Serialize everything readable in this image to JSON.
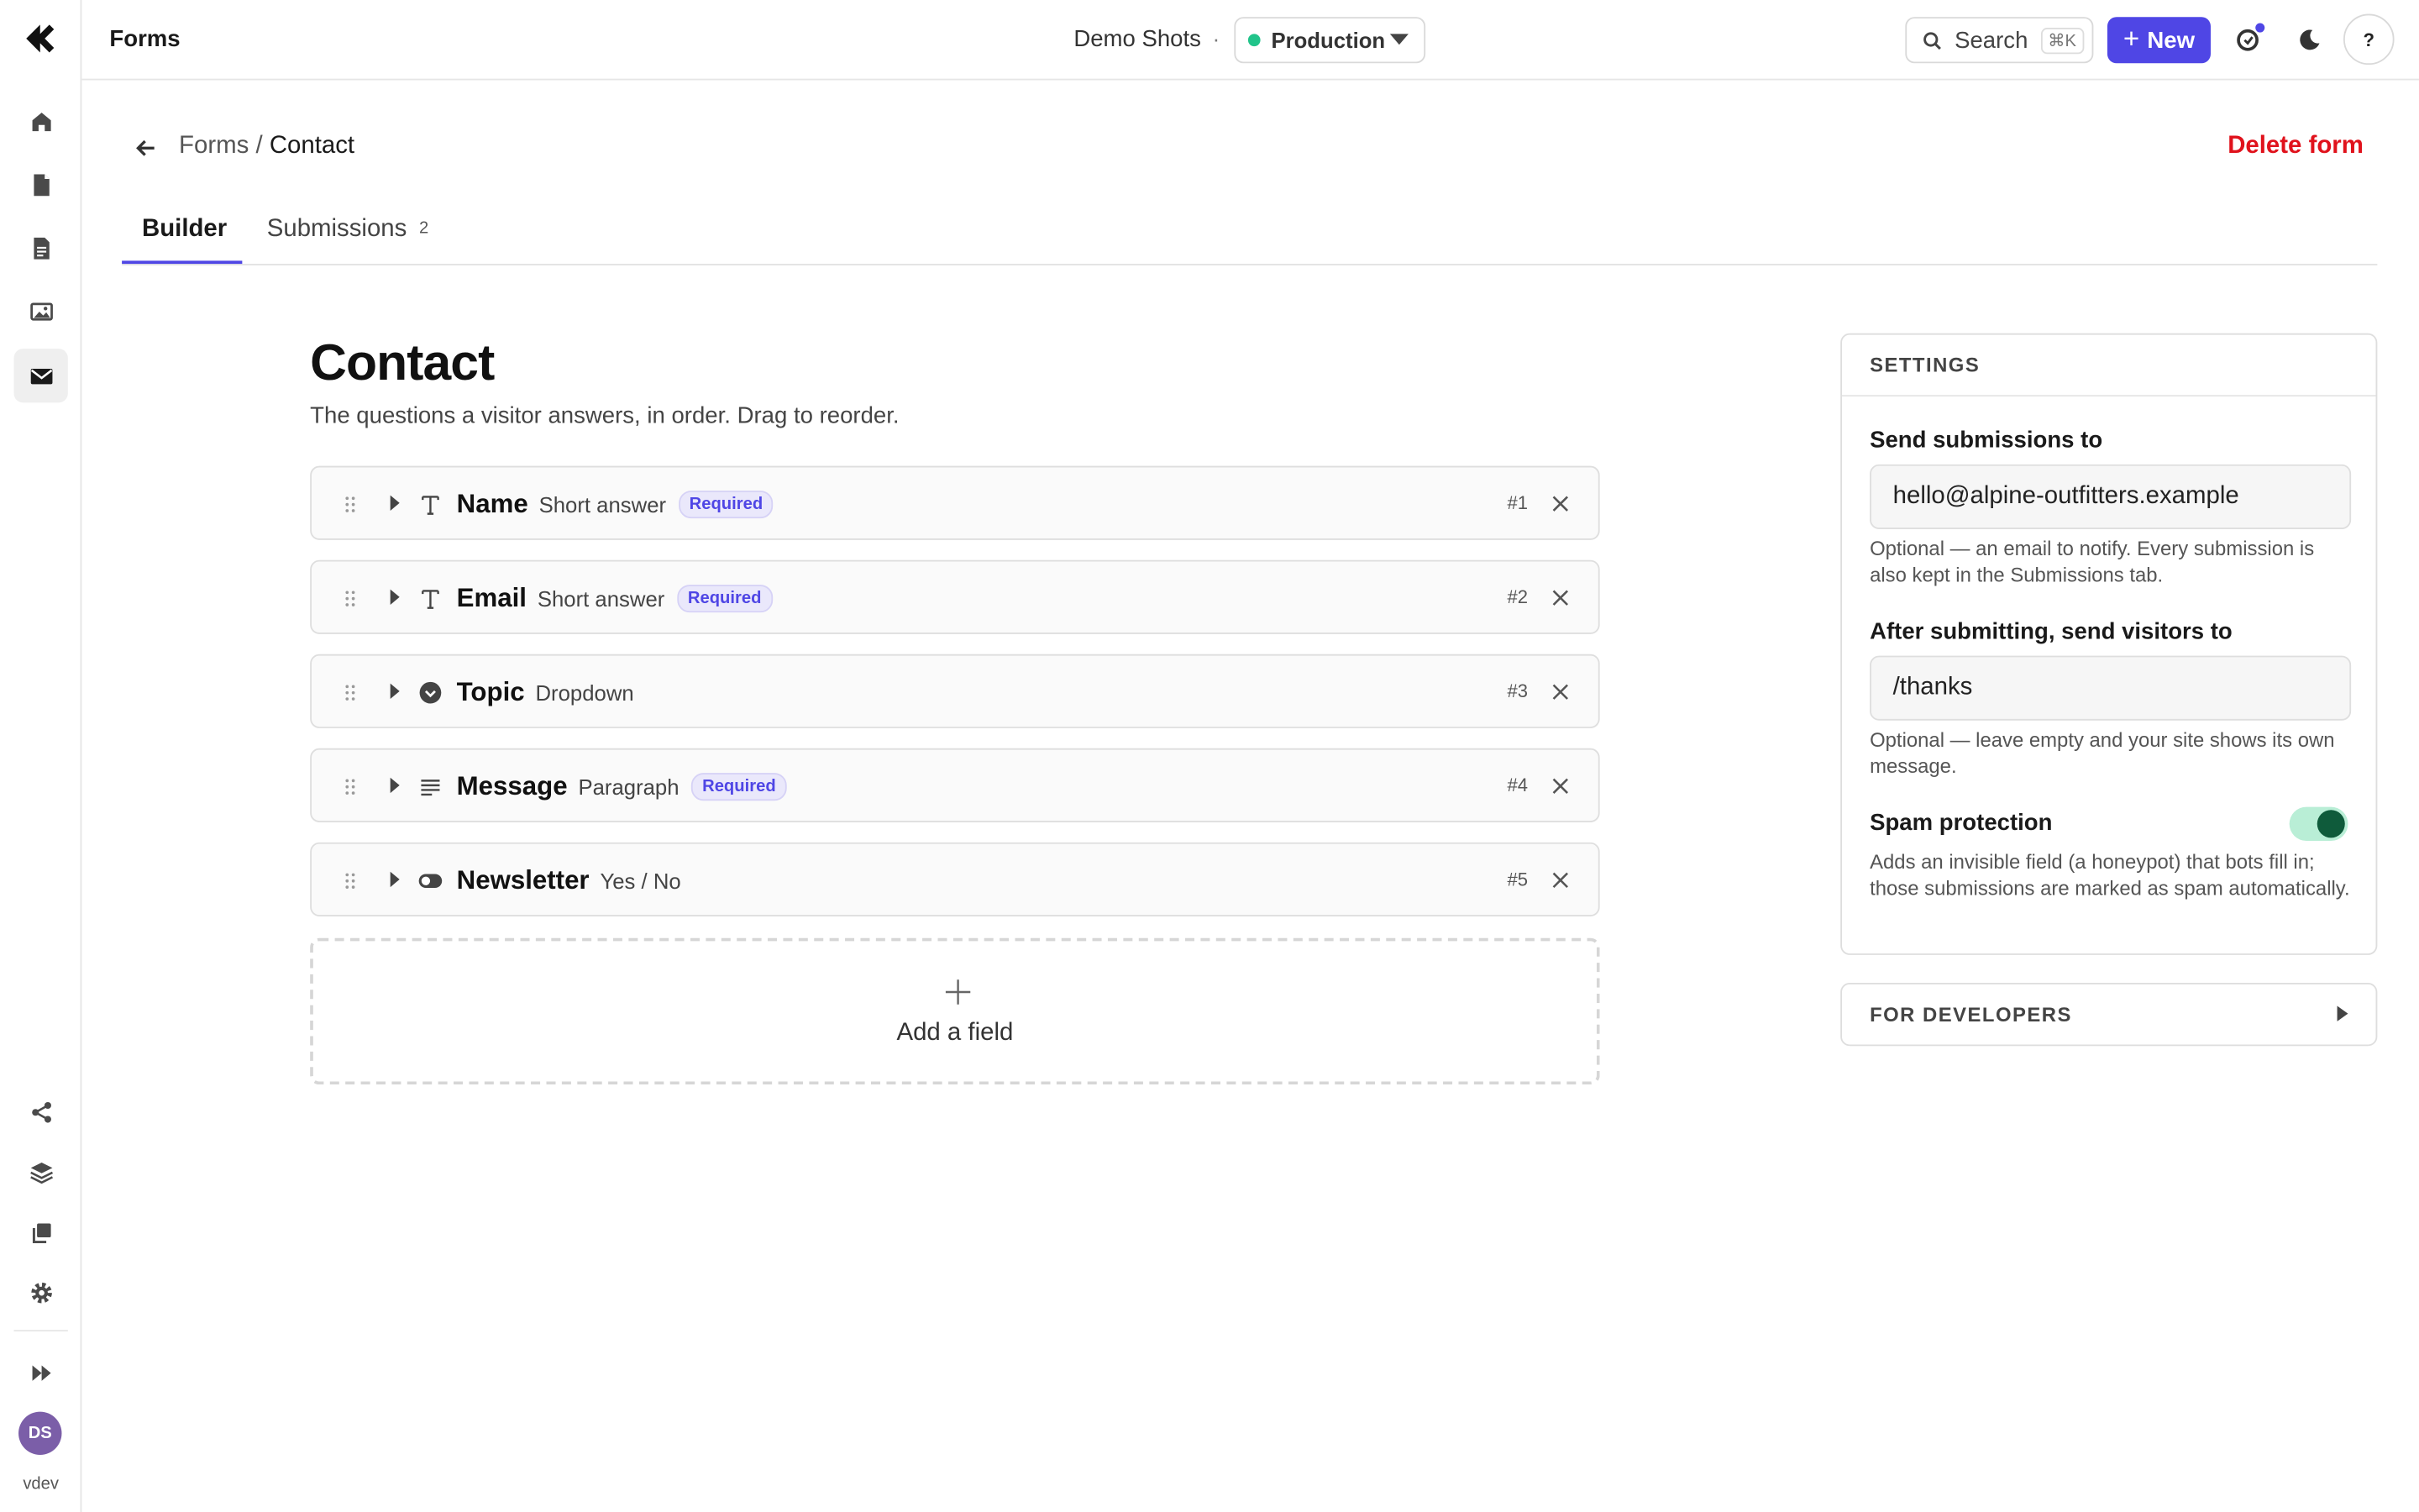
{
  "topbar": {
    "app_title": "Forms",
    "project": "Demo Shots",
    "separator": "·",
    "environment": "Production",
    "search_label": "Search",
    "search_shortcut": "⌘K",
    "new_label": "New",
    "help_label": "?"
  },
  "sidebar": {
    "items": [
      {
        "icon": "home-icon"
      },
      {
        "icon": "file-icon"
      },
      {
        "icon": "document-icon"
      },
      {
        "icon": "image-icon"
      },
      {
        "icon": "mail-icon",
        "active": true
      }
    ],
    "bottom_items": [
      {
        "icon": "share-icon"
      },
      {
        "icon": "layers-icon"
      },
      {
        "icon": "copy-icon"
      },
      {
        "icon": "gear-icon"
      },
      {
        "icon": "fast-forward-icon"
      }
    ],
    "avatar_initials": "DS",
    "user": "vdev"
  },
  "header": {
    "breadcrumb_parent": "Forms",
    "breadcrumb_sep": " / ",
    "breadcrumb_current": "Contact",
    "delete_label": "Delete form"
  },
  "tabs": [
    {
      "label": "Builder",
      "active": true
    },
    {
      "label": "Submissions",
      "count": "2"
    }
  ],
  "form": {
    "title": "Contact",
    "subtitle": "The questions a visitor answers, in order. Drag to reorder.",
    "fields": [
      {
        "name": "Name",
        "type": "Short answer",
        "required": "Required",
        "number": "#1",
        "icon": "text-icon"
      },
      {
        "name": "Email",
        "type": "Short answer",
        "required": "Required",
        "number": "#2",
        "icon": "text-icon"
      },
      {
        "name": "Topic",
        "type": "Dropdown",
        "required": "",
        "number": "#3",
        "icon": "dropdown-icon"
      },
      {
        "name": "Message",
        "type": "Paragraph",
        "required": "Required",
        "number": "#4",
        "icon": "paragraph-icon"
      },
      {
        "name": "Newsletter",
        "type": "Yes / No",
        "required": "",
        "number": "#5",
        "icon": "toggle-icon"
      }
    ],
    "add_field_label": "Add a field"
  },
  "settings": {
    "heading": "SETTINGS",
    "send_to_label": "Send submissions to",
    "send_to_value": "hello@alpine-outfitters.example",
    "send_to_help": "Optional — an email to notify. Every submission is also kept in the Submissions tab.",
    "redirect_label": "After submitting, send visitors to",
    "redirect_value": "/thanks",
    "redirect_help": "Optional — leave empty and your site shows its own message.",
    "spam_label": "Spam protection",
    "spam_enabled": true,
    "spam_help": "Adds an invisible field (a honeypot) that bots fill in; those submissions are marked as spam automatically."
  },
  "developers": {
    "heading": "FOR DEVELOPERS"
  },
  "colors": {
    "accent": "#4f46e5",
    "danger": "#e0121c",
    "env_status": "#21c48a",
    "toggle_on": "#0f5b3b"
  }
}
